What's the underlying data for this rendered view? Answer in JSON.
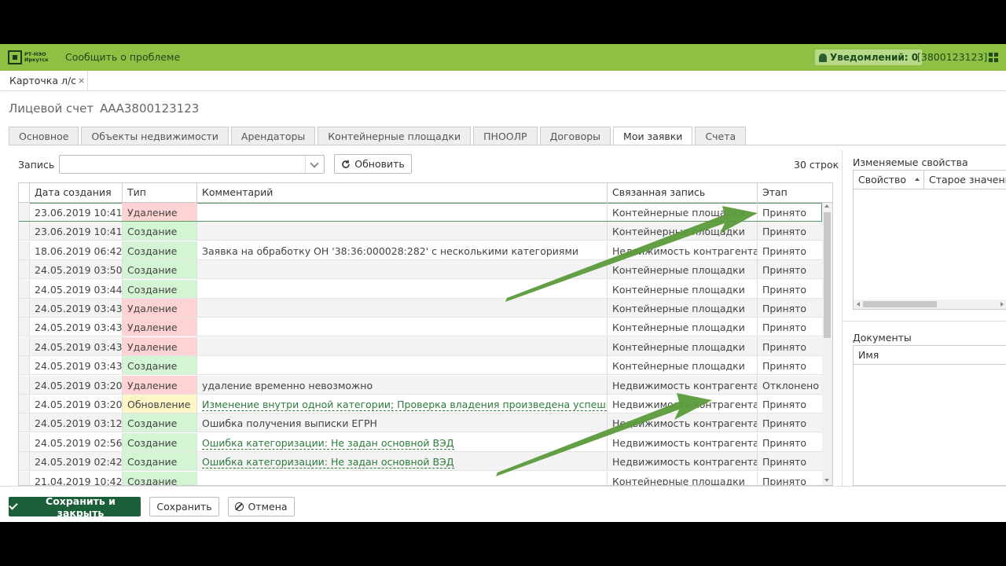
{
  "topbar": {
    "logo_line1": "РТ-НЭО",
    "logo_line2": "Иркутск",
    "report_link": "Сообщить о проблеме",
    "notifications": "Уведомлений: 0",
    "account": "[3800123123]"
  },
  "doc_tab": {
    "label": "Карточка л/с",
    "close": "×"
  },
  "page": {
    "title": "Лицевой счет",
    "number": "ААА3800123123"
  },
  "tabs": [
    {
      "label": "Основное"
    },
    {
      "label": "Объекты недвижимости"
    },
    {
      "label": "Арендаторы"
    },
    {
      "label": "Контейнерные площадки"
    },
    {
      "label": "ПНООЛР"
    },
    {
      "label": "Договоры"
    },
    {
      "label": "Мои заявки",
      "active": true
    },
    {
      "label": "Счета"
    }
  ],
  "toolbar": {
    "record_label": "Запись",
    "record_value": "",
    "refresh_label": "Обновить",
    "row_count": "30 строк"
  },
  "grid": {
    "columns": [
      "Дата создания",
      "Тип",
      "Комментарий",
      "Связанная запись",
      "Этап"
    ],
    "rows": [
      {
        "date": "23.06.2019 10:41",
        "type": "Удаление",
        "kind": "del",
        "comment": "",
        "link": false,
        "related": "Контейнерные площадки",
        "stage": "Принято"
      },
      {
        "date": "23.06.2019 10:41",
        "type": "Создание",
        "kind": "create",
        "comment": "",
        "link": false,
        "related": "Контейнерные площадки",
        "stage": "Принято"
      },
      {
        "date": "18.06.2019 06:42",
        "type": "Создание",
        "kind": "create",
        "comment": "Заявка на обработку ОН '38:36:000028:282' с несколькими категориями",
        "link": false,
        "related": "Недвижимость контрагента",
        "stage": "Принято"
      },
      {
        "date": "24.05.2019 03:50",
        "type": "Создание",
        "kind": "create",
        "comment": "",
        "link": false,
        "related": "Контейнерные площадки",
        "stage": "Принято"
      },
      {
        "date": "24.05.2019 03:44",
        "type": "Создание",
        "kind": "create",
        "comment": "",
        "link": false,
        "related": "Контейнерные площадки",
        "stage": "Принято"
      },
      {
        "date": "24.05.2019 03:43",
        "type": "Удаление",
        "kind": "del",
        "comment": "",
        "link": false,
        "related": "Контейнерные площадки",
        "stage": "Принято"
      },
      {
        "date": "24.05.2019 03:43",
        "type": "Удаление",
        "kind": "del",
        "comment": "",
        "link": false,
        "related": "Контейнерные площадки",
        "stage": "Принято"
      },
      {
        "date": "24.05.2019 03:43",
        "type": "Удаление",
        "kind": "del",
        "comment": "",
        "link": false,
        "related": "Контейнерные площадки",
        "stage": "Принято"
      },
      {
        "date": "24.05.2019 03:43",
        "type": "Создание",
        "kind": "create",
        "comment": "",
        "link": false,
        "related": "Контейнерные площадки",
        "stage": "Принято"
      },
      {
        "date": "24.05.2019 03:20",
        "type": "Удаление",
        "kind": "del",
        "comment": "удаление временно невозможно",
        "link": false,
        "related": "Недвижимость контрагента",
        "stage": "Отклонено"
      },
      {
        "date": "24.05.2019 03:20",
        "type": "Обновление",
        "kind": "update",
        "comment": "Изменение внутри одной категории; Проверка владения произведена успешно",
        "link": true,
        "related": "Недвижимость контрагента",
        "stage": "Принято"
      },
      {
        "date": "24.05.2019 03:12",
        "type": "Создание",
        "kind": "create",
        "comment": "Ошибка получения выписки ЕГРН",
        "link": false,
        "related": "Недвижимость контрагента",
        "stage": "Принято"
      },
      {
        "date": "24.05.2019 02:56",
        "type": "Создание",
        "kind": "create",
        "comment": "Ошибка категоризации: Не задан основной ВЭД",
        "link": true,
        "related": "Недвижимость контрагента",
        "stage": "Принято"
      },
      {
        "date": "24.05.2019 02:42",
        "type": "Создание",
        "kind": "create",
        "comment": "Ошибка категоризации: Не задан основной ВЭД",
        "link": true,
        "related": "Недвижимость контрагента",
        "stage": "Принято"
      },
      {
        "date": "21.04.2019 10:42",
        "type": "Создание",
        "kind": "create",
        "comment": "",
        "link": false,
        "related": "Контейнерные площадки",
        "stage": "Принято"
      }
    ]
  },
  "props_panel": {
    "title": "Изменяемые свойства",
    "col1": "Свойство",
    "col2": "Старое значение"
  },
  "docs_panel": {
    "title": "Документы",
    "col1": "Имя"
  },
  "footer": {
    "save_close": "Сохранить и закрыть",
    "save": "Сохранить",
    "cancel": "Отмена"
  },
  "colors": {
    "topbar": "#8fc044",
    "primary_button": "#1b5e3a",
    "arrow": "#5b9a3a",
    "type_delete": "#ffd3d3",
    "type_create": "#d3f5d3",
    "type_update": "#fff6c8"
  }
}
